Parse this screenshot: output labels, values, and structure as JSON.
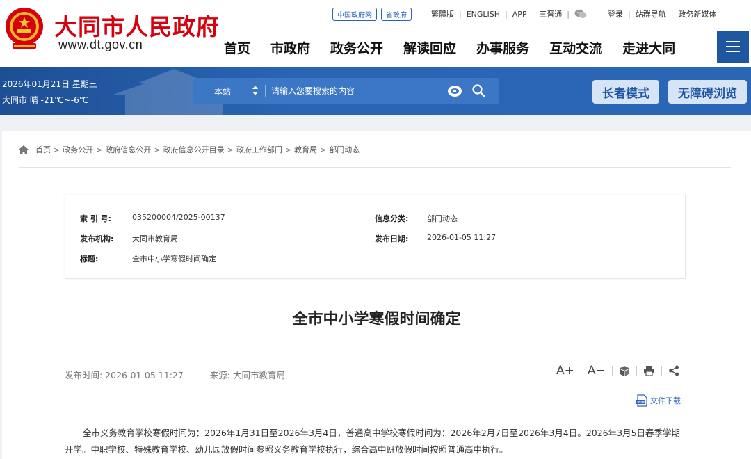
{
  "header": {
    "site_title": "大同市人民政府",
    "site_url": "www.dt.gov.cn",
    "top_pills": [
      "中国政府网",
      "省政府"
    ],
    "top_links": [
      "繁體版",
      "ENGLISH",
      "APP",
      "三晋通"
    ],
    "user_links": [
      "登录",
      "站群导航",
      "政务新媒体"
    ],
    "nav": [
      "首页",
      "市政府",
      "政务公开",
      "解读回应",
      "办事服务",
      "互动交流",
      "走进大同"
    ]
  },
  "band": {
    "date": "2026年01月21日 星期三",
    "weather": "大同市 晴 -21℃~-6℃",
    "search_scope": "本站",
    "search_placeholder": "请输入您要搜索的内容",
    "elder_mode": "长者模式",
    "accessible": "无障碍浏览"
  },
  "breadcrumb": [
    "首页",
    "政务公开",
    "政府信息公开",
    "政府信息公开目录",
    "政府工作部门",
    "教育局",
    "部门动态"
  ],
  "meta": {
    "index_label": "索 引 号:",
    "index_value": "035200004/2025-00137",
    "category_label": "信息分类:",
    "category_value": "部门动态",
    "publisher_label": "发布机构:",
    "publisher_value": "大同市教育局",
    "date_label": "发布日期:",
    "date_value": "2026-01-05 11:27",
    "title_label": "标题:",
    "title_value": "全市中小学寒假时间确定"
  },
  "article": {
    "title": "全市中小学寒假时间确定",
    "pub_time": "发布时间: 2026-01-05 11:27",
    "source": "来源: 大同市教育局",
    "tool_font_up": "A+",
    "tool_font_down": "A−",
    "download": "文件下载",
    "body": "全市义务教育学校寒假时间为：2026年1月31日至2026年3月4日，普通高中学校寒假时间为：2026年2月7日至2026年3月4日。2026年3月5日春季学期开学。中职学校、特殊教育学校、幼儿园放假时间参照义务教育学校执行，综合高中班放假时间按照普通高中执行。"
  },
  "colors": {
    "brand_red": "#d7000f",
    "brand_blue": "#1e56a0",
    "link_blue": "#2b63b7"
  }
}
